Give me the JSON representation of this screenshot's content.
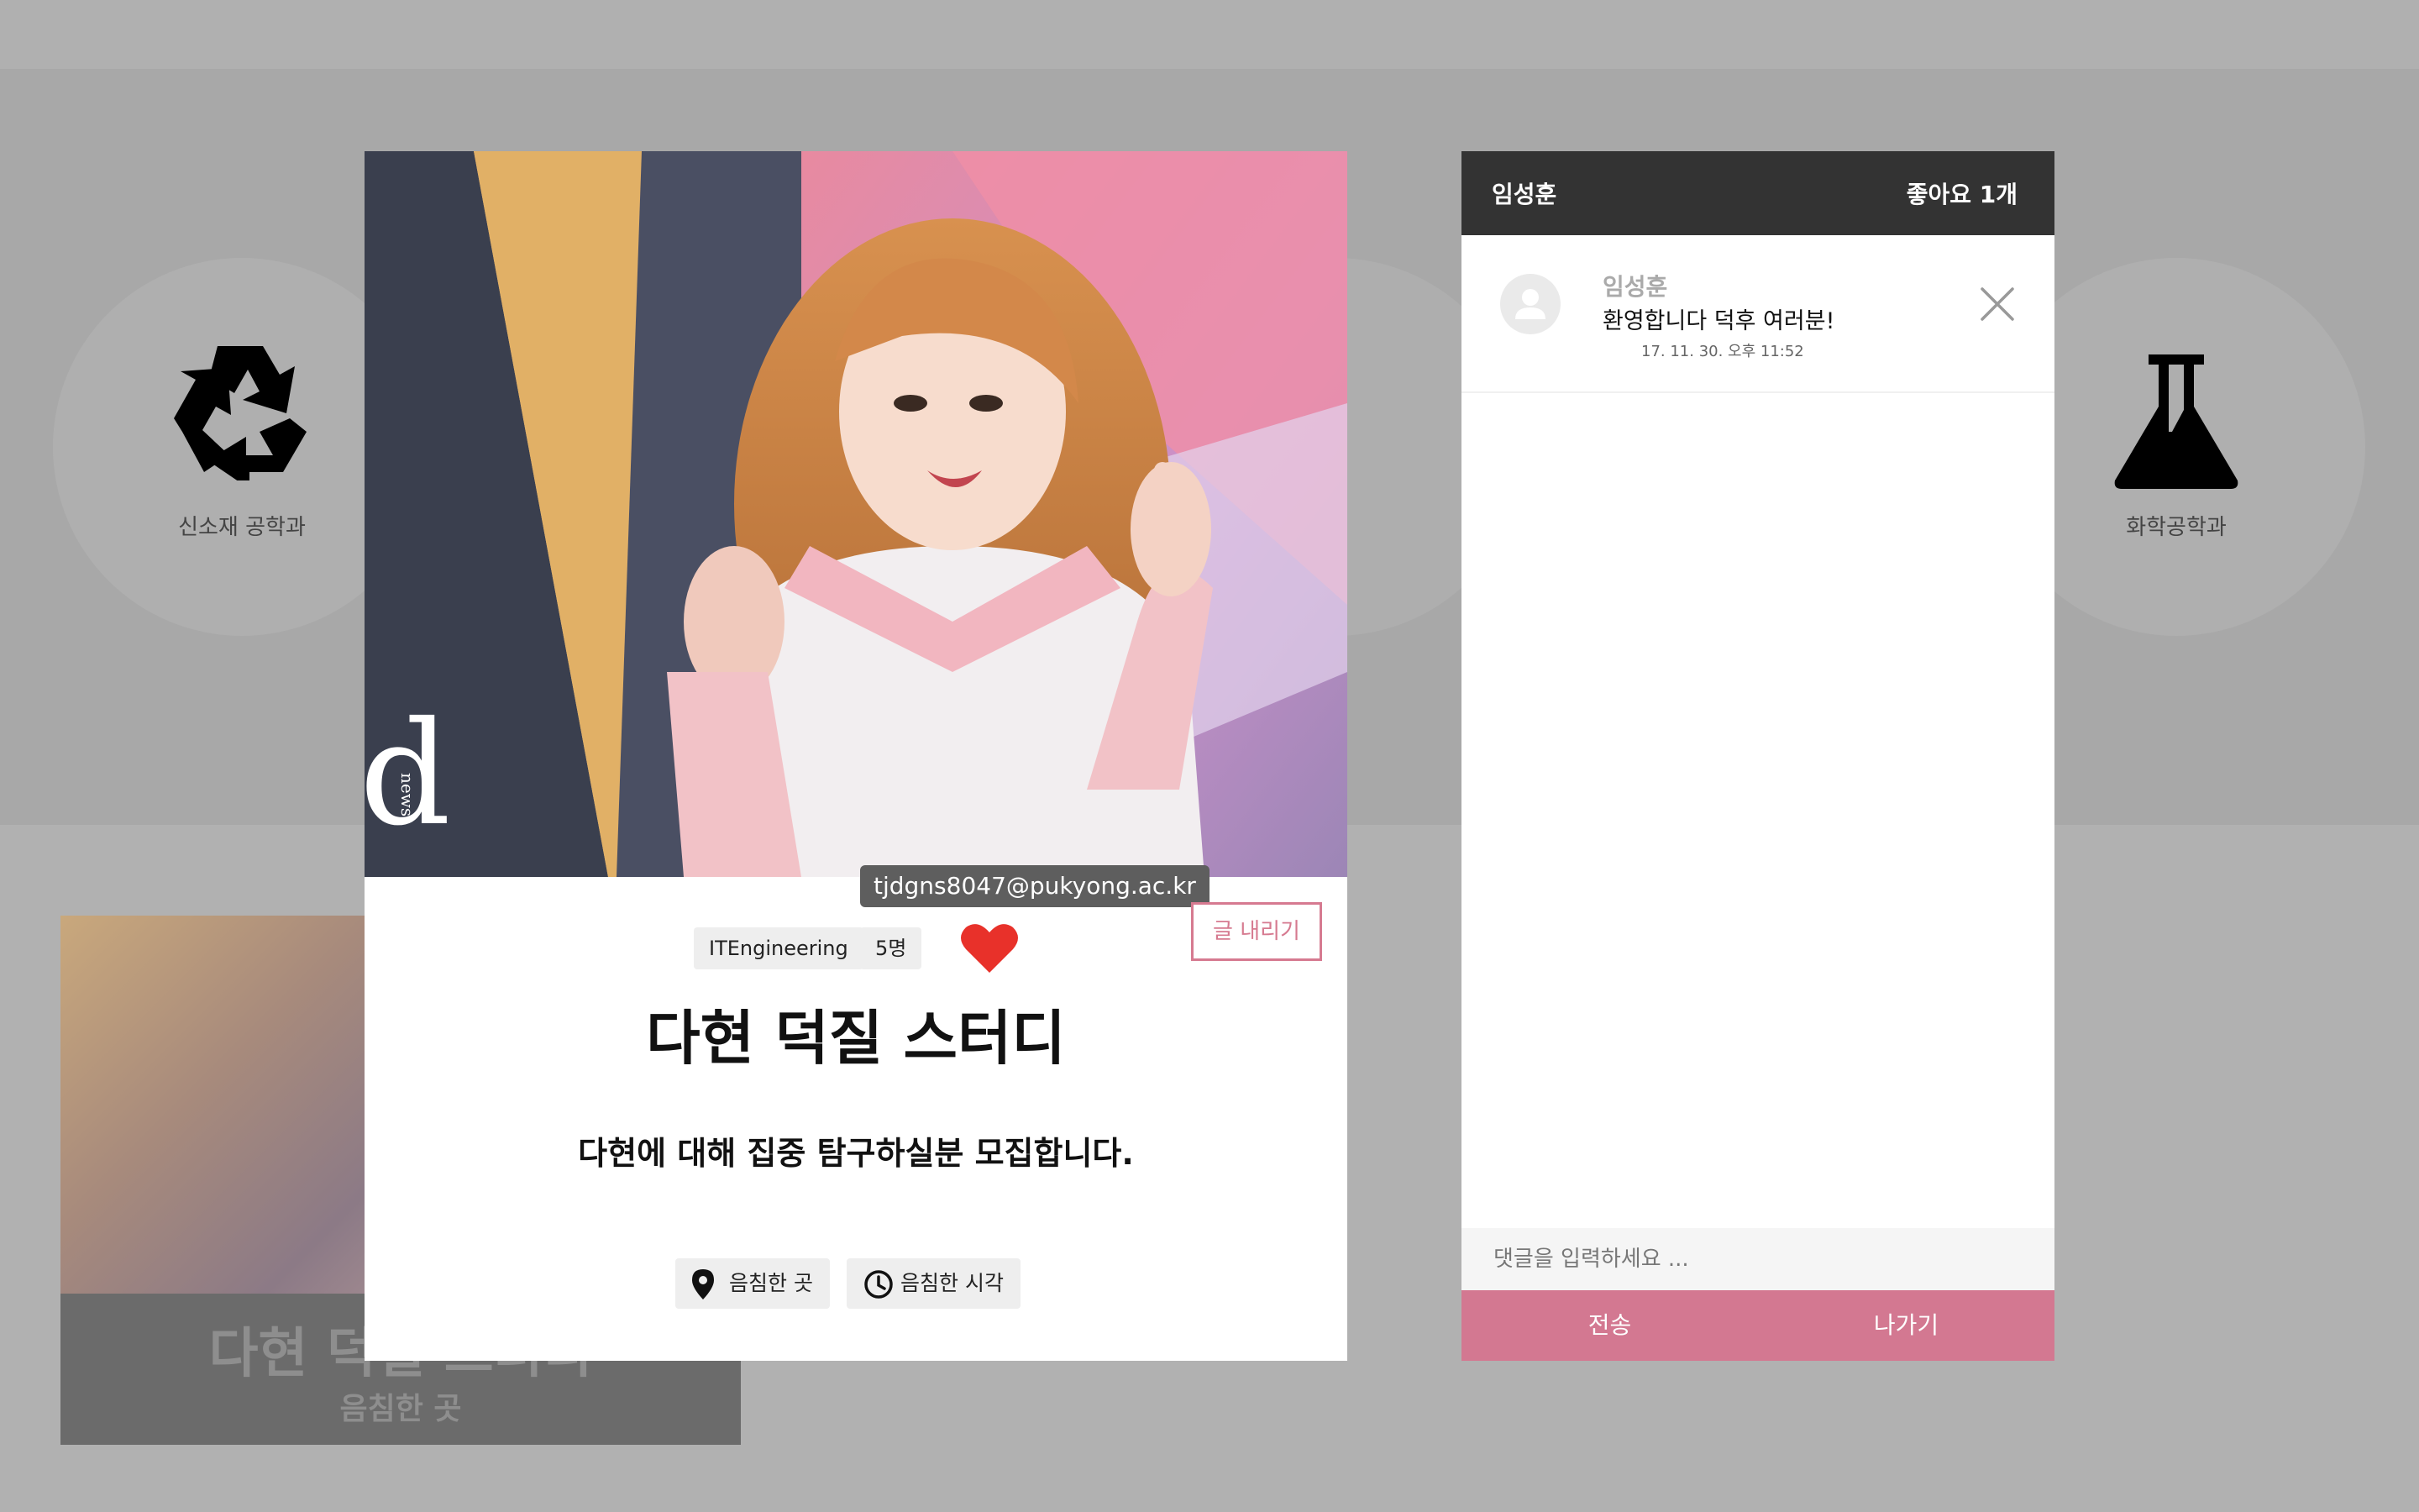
{
  "background": {
    "departments": [
      {
        "label": "신소재 공학과",
        "icon": "recycle-icon"
      },
      {
        "label": "화학공학과",
        "icon": "flask-icon"
      }
    ],
    "card": {
      "title": "다현 덕질 스터디",
      "subtitle": "음침한 곳"
    }
  },
  "post": {
    "image_watermark": "news",
    "author_email": "tjdgns8047@pukyong.ac.kr",
    "category": "ITEngineering",
    "members": "5명",
    "like_icon": "heart-icon",
    "unpost_label": "글 내리기",
    "title": "다현 덕질 스터디",
    "description": "다현에 대해 집중 탐구하실분 모집합니다.",
    "place": "음침한 곳",
    "time": "음침한 시각"
  },
  "comments_panel": {
    "author": "임성훈",
    "likes": "좋아요 1개",
    "comments": [
      {
        "author": "임성훈",
        "text": "환영합니다 덕후 여러분!",
        "time": "17. 11. 30. 오후 11:52"
      }
    ],
    "input_placeholder": "댓글을 입력하세요 ...",
    "send_label": "전송",
    "exit_label": "나가기"
  },
  "colors": {
    "accent_pink": "#d37891",
    "header_dark": "#333333",
    "heart_red": "#e8312a",
    "overlay_gray": "#a8a8a8"
  }
}
